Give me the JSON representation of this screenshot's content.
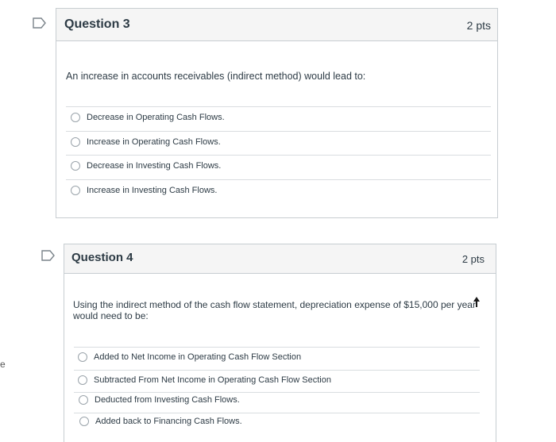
{
  "page_edge_text": "e",
  "questions": [
    {
      "title": "Question 3",
      "points": "2 pts",
      "text": "An increase in accounts receivables (indirect method) would lead to:",
      "options": [
        "Decrease in Operating Cash Flows.",
        "Increase in Operating Cash Flows.",
        "Decrease in Investing Cash Flows.",
        "Increase in Investing Cash Flows."
      ]
    },
    {
      "title": "Question 4",
      "points": "2 pts",
      "text_line1": "Using the indirect method of the cash flow statement, depreciation expense of $15,000 per year",
      "text_line2": "would need to be:",
      "options": [
        "Added to Net Income in Operating Cash Flow Section",
        "Subtracted From Net Income in Operating Cash Flow Section",
        "Deducted from Investing Cash Flows.",
        "Added back to Financing Cash Flows."
      ]
    }
  ]
}
